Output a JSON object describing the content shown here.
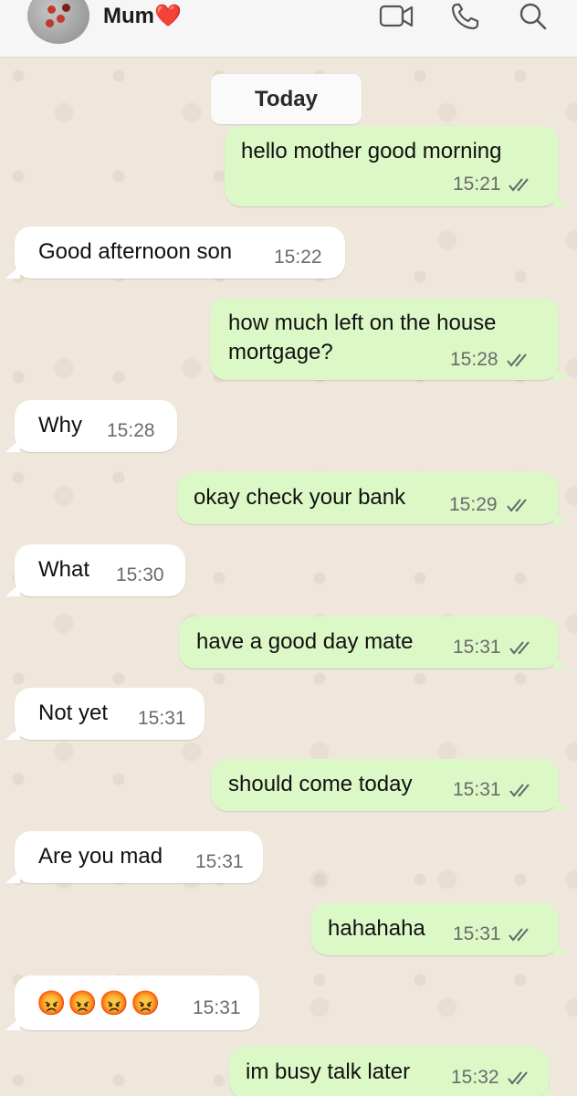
{
  "header": {
    "contact_name": "Mum❤️",
    "icons": [
      "video-call-icon",
      "phone-icon",
      "search-icon"
    ]
  },
  "date_chip": "Today",
  "messages": [
    {
      "dir": "out",
      "text": "hello mother good morning",
      "time": "15:21",
      "read": true
    },
    {
      "dir": "in",
      "text": "Good afternoon son",
      "time": "15:22"
    },
    {
      "dir": "out",
      "text": "how much left on the house\nmortgage?",
      "time": "15:28",
      "read": true
    },
    {
      "dir": "in",
      "text": "Why",
      "time": "15:28"
    },
    {
      "dir": "out",
      "text": "okay check your bank",
      "time": "15:29",
      "read": true
    },
    {
      "dir": "in",
      "text": "What",
      "time": "15:30"
    },
    {
      "dir": "out",
      "text": "have a good day mate",
      "time": "15:31",
      "read": true
    },
    {
      "dir": "in",
      "text": "Not yet",
      "time": "15:31"
    },
    {
      "dir": "out",
      "text": "should come today",
      "time": "15:31",
      "read": true
    },
    {
      "dir": "in",
      "text": "Are you mad",
      "time": "15:31"
    },
    {
      "dir": "out",
      "text": "hahahaha",
      "time": "15:31",
      "read": true
    },
    {
      "dir": "in",
      "text": "😡😡😡😡",
      "time": "15:31"
    },
    {
      "dir": "out",
      "text": "im busy talk later",
      "time": "15:32",
      "read": true
    }
  ],
  "colors": {
    "outgoing_bubble": "#dcf8c6",
    "incoming_bubble": "#ffffff",
    "chat_background": "#efe7dc",
    "read_ticks": "#5b6b66"
  }
}
